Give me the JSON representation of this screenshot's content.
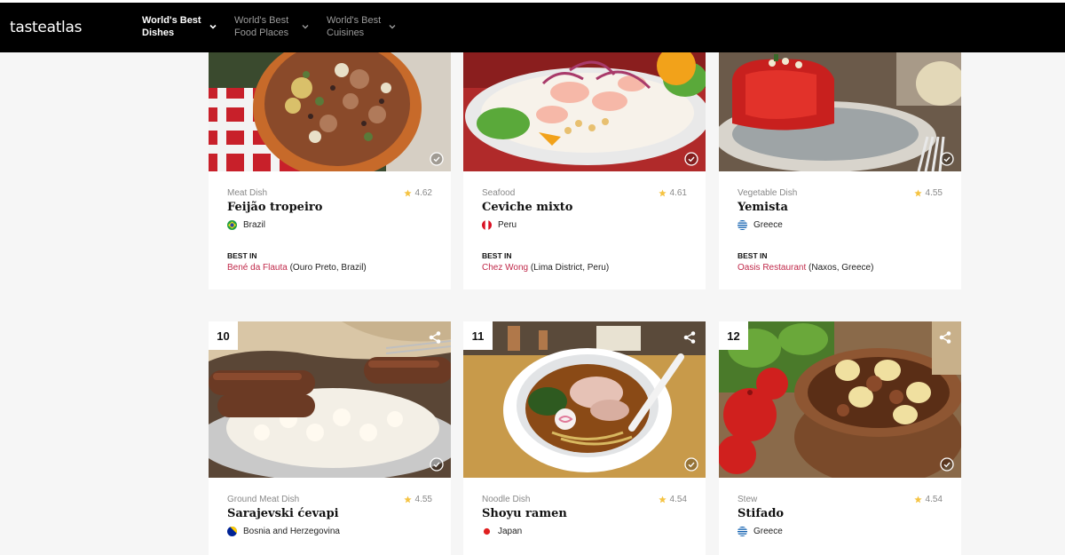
{
  "header": {
    "logo": {
      "left": "taste",
      "right": "atlas"
    },
    "nav": [
      {
        "label": "World's Best\nDishes",
        "active": true
      },
      {
        "label": "World's Best\nFood Places",
        "active": false
      },
      {
        "label": "World's Best\nCuisines",
        "active": false
      }
    ]
  },
  "best_in_label": "BEST IN",
  "cards": [
    {
      "category": "Meat Dish",
      "rating": "4.62",
      "name": "Feijão tropeiro",
      "country": "Brazil",
      "flag": "brazil",
      "place": "Bené da Flauta",
      "place_location": " (Ouro Preto, Brazil)"
    },
    {
      "category": "Seafood",
      "rating": "4.61",
      "name": "Ceviche mixto",
      "country": "Peru",
      "flag": "peru",
      "place": "Chez Wong",
      "place_location": " (Lima District, Peru)"
    },
    {
      "category": "Vegetable Dish",
      "rating": "4.55",
      "name": "Yemista",
      "country": "Greece",
      "flag": "greece",
      "place": "Oasis Restaurant",
      "place_location": " (Naxos, Greece)"
    },
    {
      "rank": "10",
      "category": "Ground Meat Dish",
      "rating": "4.55",
      "name": "Sarajevski ćevapi",
      "country": "Bosnia and Herzegovina",
      "flag": "bosnia"
    },
    {
      "rank": "11",
      "category": "Noodle Dish",
      "rating": "4.54",
      "name": "Shoyu ramen",
      "country": "Japan",
      "flag": "japan"
    },
    {
      "rank": "12",
      "category": "Stew",
      "rating": "4.54",
      "name": "Stifado",
      "country": "Greece",
      "flag": "greece"
    }
  ],
  "colors": {
    "accent": "#c0294a",
    "star": "#f5c342",
    "topbar": "#000000"
  },
  "icons": [
    "share-icon",
    "check-circle-icon",
    "star-icon",
    "chevron-down-icon"
  ]
}
